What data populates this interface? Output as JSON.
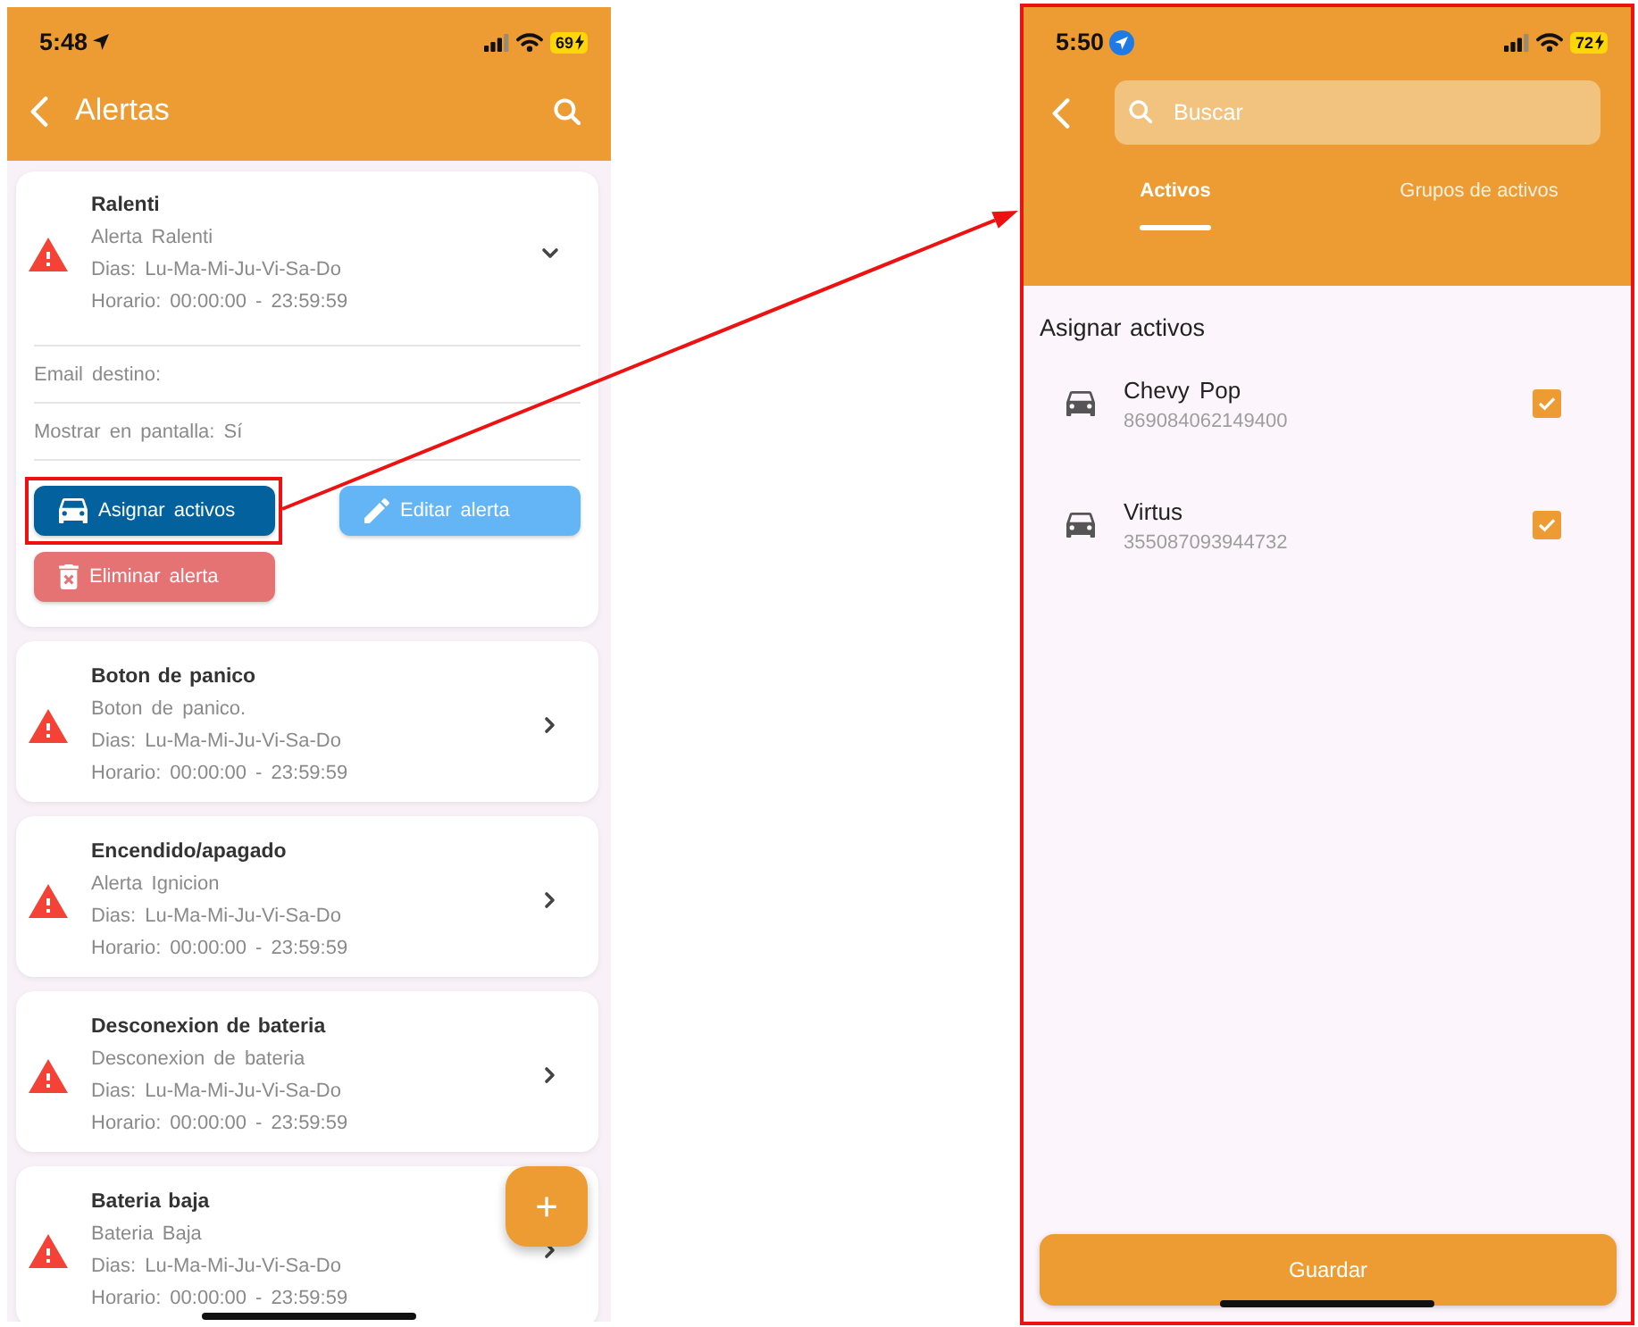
{
  "left_screen": {
    "status_bar": {
      "time": "5:48",
      "location_active": false,
      "battery": "69",
      "charging": true
    },
    "header": {
      "title": "Alertas"
    },
    "alerts": [
      {
        "title": "Ralenti",
        "description": "Alerta Ralenti",
        "days": "Dias: Lu-Ma-Mi-Ju-Vi-Sa-Do",
        "schedule": "Horario: 00:00:00 - 23:59:59",
        "expanded": true,
        "details": [
          "Email destino:",
          "Mostrar en pantalla: Sí"
        ],
        "actions": [
          {
            "label": "Asignar activos",
            "kind": "assign",
            "highlighted": true
          },
          {
            "label": "Editar alerta",
            "kind": "edit",
            "highlighted": false
          },
          {
            "label": "Eliminar alerta",
            "kind": "delete",
            "highlighted": false
          }
        ]
      },
      {
        "title": "Boton de panico",
        "description": "Boton de panico.",
        "days": "Dias: Lu-Ma-Mi-Ju-Vi-Sa-Do",
        "schedule": "Horario: 00:00:00 - 23:59:59",
        "expanded": false
      },
      {
        "title": "Encendido/apagado",
        "description": "Alerta Ignicion",
        "days": "Dias: Lu-Ma-Mi-Ju-Vi-Sa-Do",
        "schedule": "Horario: 00:00:00 - 23:59:59",
        "expanded": false
      },
      {
        "title": "Desconexion de bateria",
        "description": "Desconexion de bateria",
        "days": "Dias: Lu-Ma-Mi-Ju-Vi-Sa-Do",
        "schedule": "Horario: 00:00:00 - 23:59:59",
        "expanded": false
      },
      {
        "title": "Bateria baja",
        "description": "Bateria Baja",
        "days": "Dias: Lu-Ma-Mi-Ju-Vi-Sa-Do",
        "schedule": "Horario: 00:00:00 - 23:59:59",
        "expanded": false
      }
    ],
    "fab": "+"
  },
  "right_screen": {
    "status_bar": {
      "time": "5:50",
      "location_active": true,
      "battery": "72",
      "charging": true
    },
    "search": {
      "placeholder": "Buscar"
    },
    "tabs": [
      {
        "label": "Activos",
        "selected": true
      },
      {
        "label": "Grupos de activos",
        "selected": false
      }
    ],
    "section_title": "Asignar activos",
    "assets": [
      {
        "name": "Chevy Pop",
        "id": "869084062149400",
        "checked": true
      },
      {
        "name": "Virtus",
        "id": "355087093944732",
        "checked": true
      }
    ],
    "save_button": "Guardar"
  }
}
